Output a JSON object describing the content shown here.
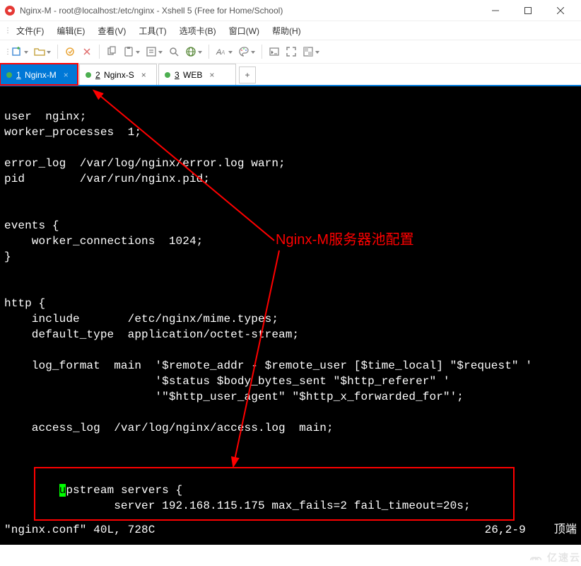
{
  "window": {
    "title": "Nginx-M - root@localhost:/etc/nginx - Xshell 5 (Free for Home/School)"
  },
  "menu": {
    "file": "文件(F)",
    "edit": "编辑(E)",
    "view": "查看(V)",
    "tools": "工具(T)",
    "tabs": "选项卡(B)",
    "window": "窗口(W)",
    "help": "帮助(H)"
  },
  "tabs": [
    {
      "num": "1",
      "label": "Nginx-M",
      "active": true
    },
    {
      "num": "2",
      "label": "Nginx-S",
      "active": false
    },
    {
      "num": "3",
      "label": "WEB",
      "active": false
    }
  ],
  "tab_add": "+",
  "annotation": {
    "label": "Nginx-M服务器池配置"
  },
  "terminal": {
    "lines": [
      "",
      "user  nginx;",
      "worker_processes  1;",
      "",
      "error_log  /var/log/nginx/error.log warn;",
      "pid        /var/run/nginx.pid;",
      "",
      "",
      "events {",
      "    worker_connections  1024;",
      "}",
      "",
      "",
      "http {",
      "    include       /etc/nginx/mime.types;",
      "    default_type  application/octet-stream;",
      "",
      "    log_format  main  '$remote_addr - $remote_user [$time_local] \"$request\" '",
      "                      '$status $body_bytes_sent \"$http_referer\" '",
      "                      '\"$http_user_agent\" \"$http_x_forwarded_for\"';",
      "",
      "    access_log  /var/log/nginx/access.log  main;",
      "",
      "",
      ""
    ],
    "upstream_prefix": "        ",
    "upstream_first": "u",
    "upstream_rest": "pstream servers {",
    "upstream_line2": "                server 192.168.115.175 max_fails=2 fail_timeout=20s;",
    "spacer": "",
    "status_file": "\"nginx.conf\" 40L, 728C",
    "status_pos": "26,2-9",
    "status_scroll": "顶端"
  },
  "watermark": "亿速云"
}
